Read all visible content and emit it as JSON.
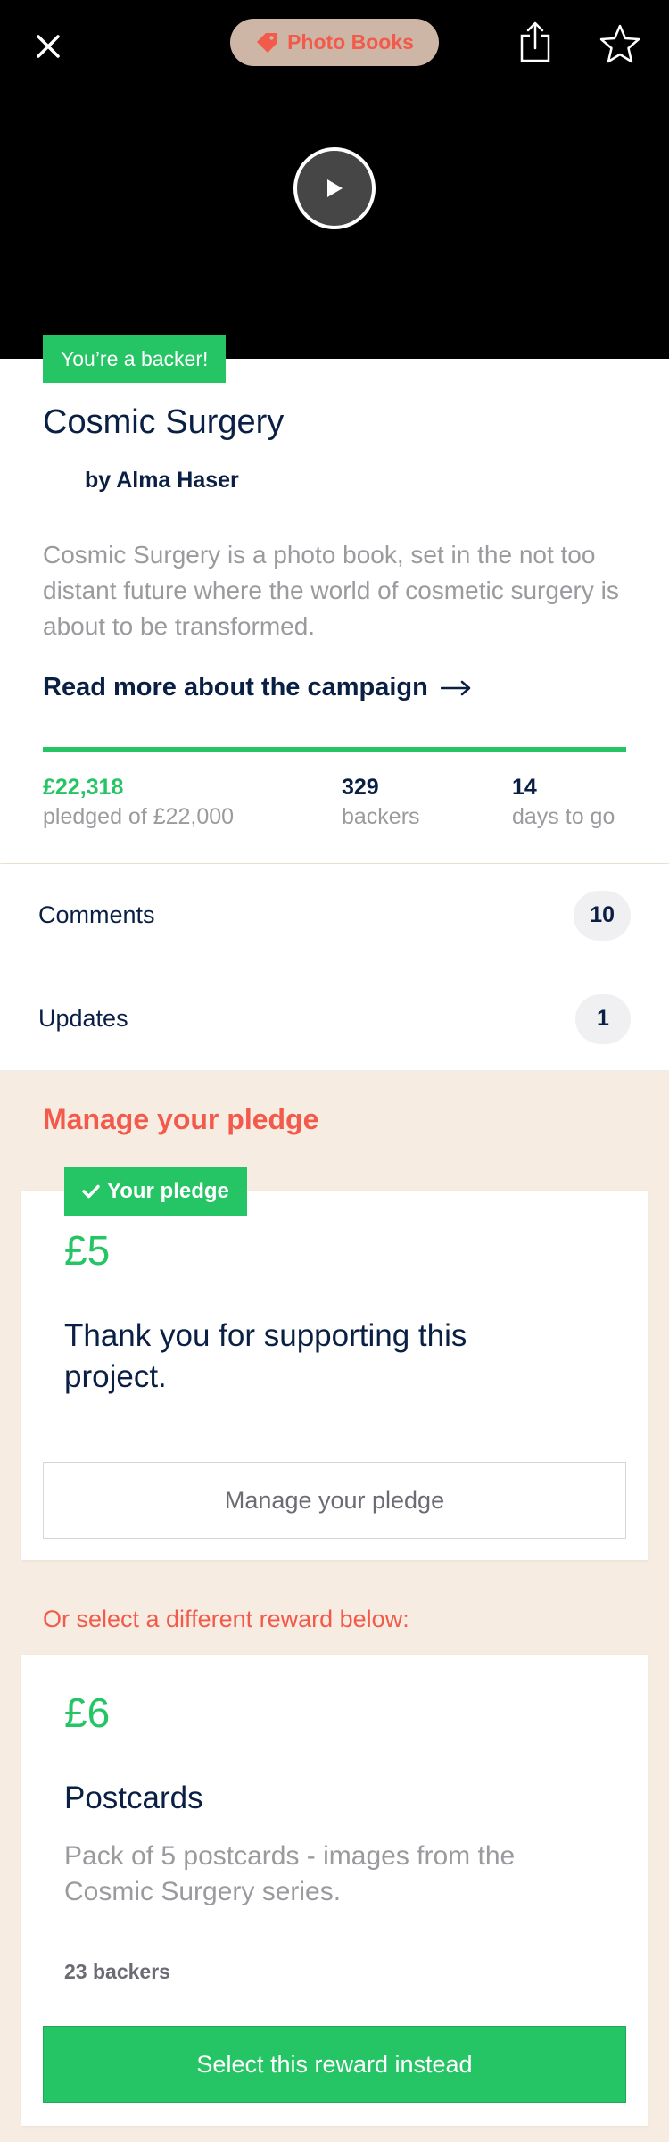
{
  "header": {
    "category_label": "Photo Books",
    "icons": [
      "close-icon",
      "tag-icon",
      "share-icon",
      "star-icon",
      "play-icon"
    ]
  },
  "project": {
    "backer_badge": "You’re a backer!",
    "title": "Cosmic Surgery",
    "creator": "by Alma Haser",
    "blurb": "Cosmic Surgery is a photo book, set in the not too distant future where the world of cosmetic surgery is about to be transformed.",
    "read_more": "Read more about the campaign",
    "funding_progress": 1.0,
    "stats": {
      "pledged_value": "£22,318",
      "pledged_label": "pledged of £22,000",
      "backers_value": "329",
      "backers_label": "backers",
      "days_value": "14",
      "days_label": "days to go"
    }
  },
  "rows": {
    "comments_label": "Comments",
    "comments_count": "10",
    "updates_label": "Updates",
    "updates_count": "1"
  },
  "pledge": {
    "section_title": "Manage your pledge",
    "badge_label": "Your pledge",
    "amount": "£5",
    "thanks": "Thank you for supporting this project.",
    "manage_button": "Manage your pledge"
  },
  "rewards": {
    "alt_title": "Or select a different reward below:",
    "items": [
      {
        "amount": "£6",
        "name": "Postcards",
        "description": "Pack of 5 postcards - images from the Cosmic Surgery series.",
        "backers": "23 backers",
        "select_button": "Select this reward instead"
      }
    ]
  },
  "colors": {
    "accent_green": "#25c465",
    "accent_red": "#f25a4b",
    "navy_text": "#0a1f44",
    "section_bg": "#f7ece1"
  }
}
